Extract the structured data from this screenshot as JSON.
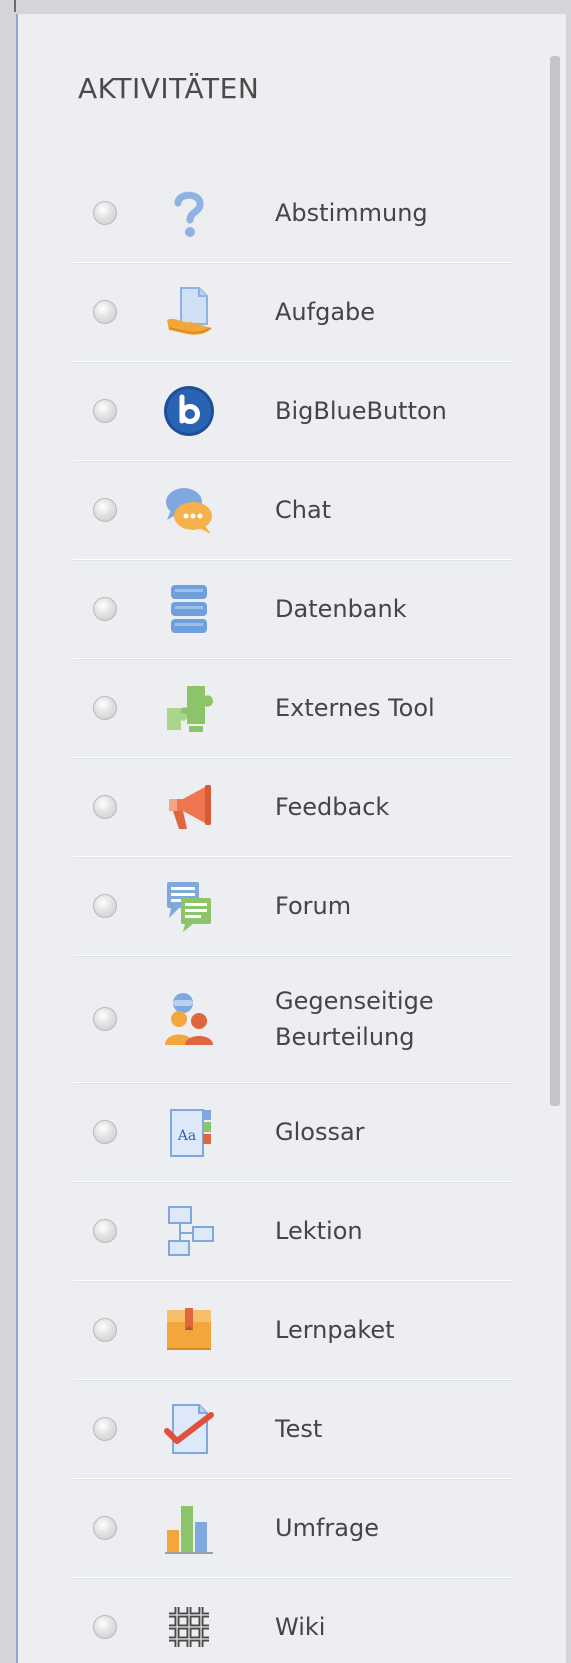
{
  "section": {
    "title": "AKTIVITÄTEN"
  },
  "activities": [
    {
      "label": "Abstimmung",
      "icon": "question-mark-icon"
    },
    {
      "label": "Aufgabe",
      "icon": "assignment-document-icon"
    },
    {
      "label": "BigBlueButton",
      "icon": "bigbluebutton-logo-icon"
    },
    {
      "label": "Chat",
      "icon": "chat-bubbles-icon"
    },
    {
      "label": "Datenbank",
      "icon": "database-stack-icon"
    },
    {
      "label": "Externes Tool",
      "icon": "puzzle-piece-icon"
    },
    {
      "label": "Feedback",
      "icon": "megaphone-icon"
    },
    {
      "label": "Forum",
      "icon": "forum-bubbles-icon"
    },
    {
      "label": "Gegenseitige Beurteilung",
      "icon": "peer-assessment-people-icon"
    },
    {
      "label": "Glossar",
      "icon": "glossary-book-icon"
    },
    {
      "label": "Lektion",
      "icon": "lesson-flowchart-icon"
    },
    {
      "label": "Lernpaket",
      "icon": "package-box-icon"
    },
    {
      "label": "Test",
      "icon": "quiz-checkmark-icon"
    },
    {
      "label": "Umfrage",
      "icon": "bar-chart-icon"
    },
    {
      "label": "Wiki",
      "icon": "wiki-knot-icon"
    }
  ],
  "colors": {
    "panel_background": "#eceef1",
    "panel_border": "#8ba9d4",
    "text": "#454545"
  }
}
